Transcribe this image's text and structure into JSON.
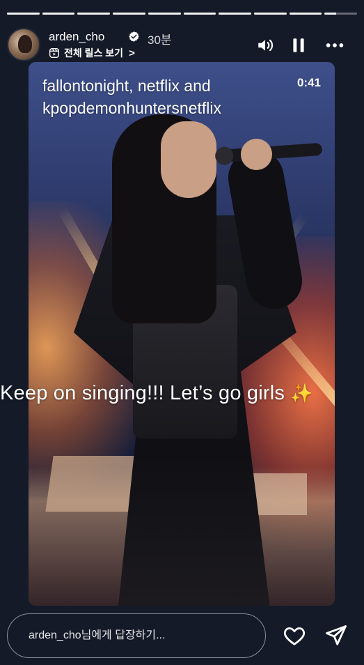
{
  "story": {
    "segments": [
      1,
      1,
      1,
      1,
      1,
      1,
      1,
      1,
      1,
      0.35
    ],
    "username": "arden_cho",
    "time_ago": "30분",
    "reels_link": "전체 릴스 보기",
    "reels_chevron": ">",
    "icons": {
      "verified": "verified-badge-icon",
      "reels": "reels-icon",
      "sound": "speaker-icon",
      "pause": "pause-icon",
      "more": "more-dots-icon",
      "like": "heart-icon",
      "send": "send-icon"
    }
  },
  "media": {
    "overlay_lines": [
      "fallontonight, netflix and",
      "kpopdemonhuntersnetflix"
    ],
    "video_time": "0:41",
    "caption": "Keep on singing!!! Let’s go girls",
    "caption_emoji": "✨"
  },
  "footer": {
    "reply_placeholder": "arden_cho님에게 답장하기..."
  },
  "colors": {
    "background": "#141a28",
    "progress_fill": "#f2f2f2",
    "sparkle": "#ffd54a"
  }
}
